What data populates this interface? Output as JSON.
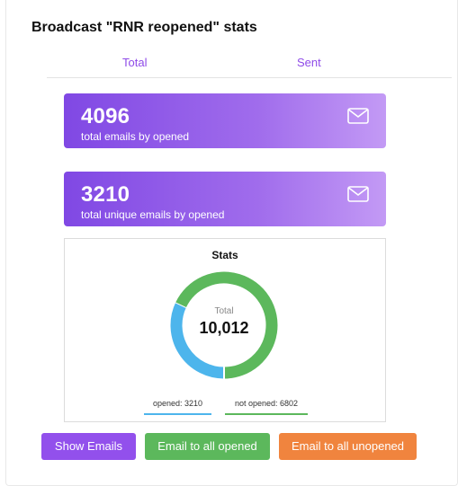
{
  "page": {
    "title": "Broadcast \"RNR reopened\" stats"
  },
  "tabs": [
    {
      "label": "Total"
    },
    {
      "label": "Sent"
    }
  ],
  "stat_cards": [
    {
      "value": "4096",
      "label": "total emails by opened",
      "icon": "mail-icon"
    },
    {
      "value": "3210",
      "label": "total unique emails by opened",
      "icon": "mail-icon"
    }
  ],
  "stats_chart": {
    "title": "Stats",
    "center_label": "Total",
    "center_value": "10,012",
    "legend": [
      {
        "text": "opened: 3210",
        "color": "#4db5ec"
      },
      {
        "text": "not opened: 6802",
        "color": "#5cb85c"
      }
    ]
  },
  "chart_data": {
    "type": "pie",
    "title": "Stats",
    "donut": true,
    "total": 10012,
    "categories": [
      "opened",
      "not opened"
    ],
    "values": [
      3210,
      6802
    ],
    "colors": [
      "#4db5ec",
      "#5cb85c"
    ]
  },
  "buttons": [
    {
      "label": "Show Emails",
      "color": "#9250ec"
    },
    {
      "label": "Email to all opened",
      "color": "#5cb85c"
    },
    {
      "label": "Email to all unopened",
      "color": "#f0843e"
    }
  ]
}
